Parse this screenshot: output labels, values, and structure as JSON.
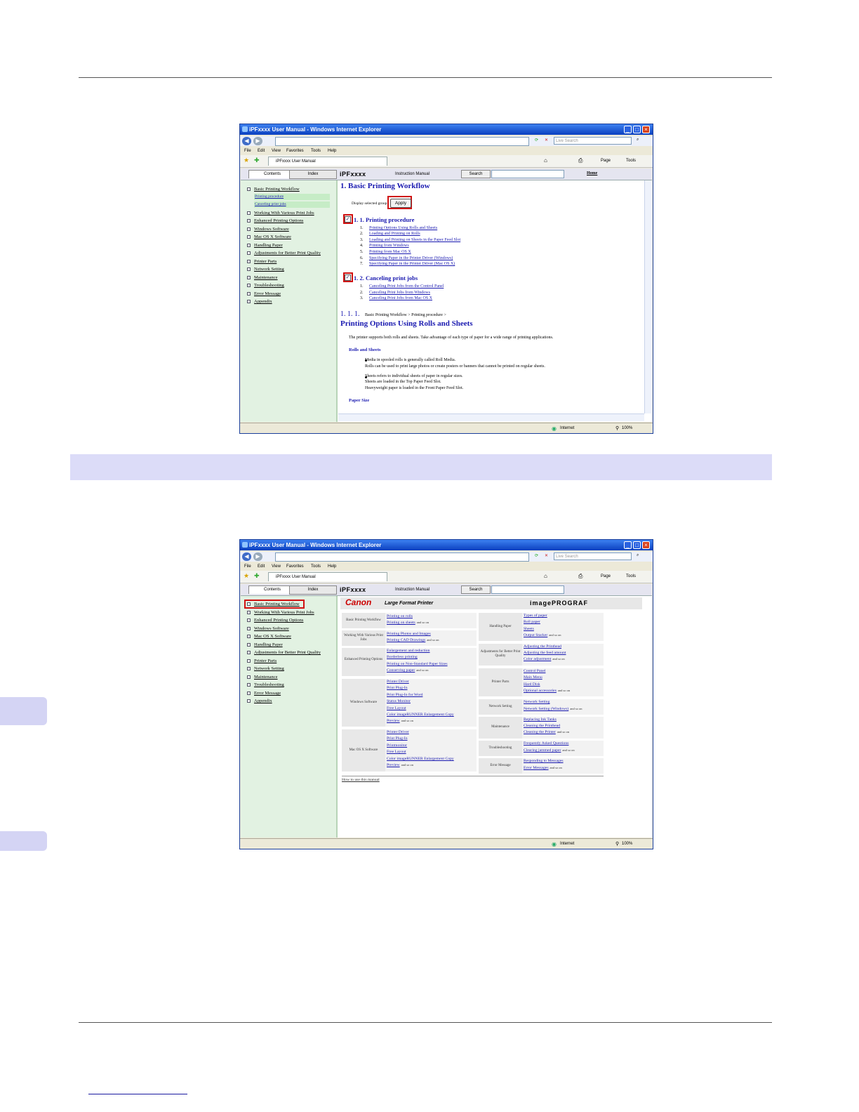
{
  "browser": {
    "title": "iPFxxxx User Manual - Windows Internet Explorer",
    "search_placeholder": "Live Search",
    "menus": [
      "File",
      "Edit",
      "View",
      "Favorites",
      "Tools",
      "Help"
    ],
    "tab_label": "iPFxxxx User Manual",
    "page_label": "Page",
    "tools_label": "Tools",
    "status_zone": "Internet",
    "zoom": "100%"
  },
  "help": {
    "tab_contents": "Contents",
    "tab_index": "Index",
    "brand": "iPFxxxx",
    "manual_label": "Instruction Manual",
    "search_button": "Search",
    "home_link": "Home",
    "sidebar": [
      "Basic Printing Workflow",
      "Working With Various Print Jobs",
      "Enhanced Printing Options",
      "Windows Software",
      "Mac OS X Software",
      "Handling Paper",
      "Adjustments for Better Print Quality",
      "Printer Parts",
      "Network Setting",
      "Maintenance",
      "Troubleshooting",
      "Error Message",
      "Appendix"
    ]
  },
  "screen1": {
    "sub_items": [
      "Printing procedure",
      "Canceling print jobs"
    ],
    "heading": "1. Basic Printing Workflow",
    "display_label": "Display selected group",
    "apply_button": "Apply",
    "group1": {
      "title": "1. 1. Printing procedure",
      "links": [
        "Printing Options Using Rolls and Sheets",
        "Loading and Printing on Rolls",
        "Loading and Printing on Sheets in the Paper Feed Slot",
        "Printing from Windows",
        "Printing from Mac OS X",
        "Specifying Paper in the Printer Driver (Windows)",
        "Specifying Paper in the Printer Driver (Mac OS X)"
      ]
    },
    "group2": {
      "title": "1. 2. Canceling print jobs",
      "links": [
        "Canceling Print Jobs from the Control Panel",
        "Canceling Print Jobs from Windows",
        "Canceling Print Jobs from Mac OS X"
      ]
    },
    "section_num": "1. 1. 1.",
    "breadcrumb": "Basic Printing Workflow > Printing procedure >",
    "section_title": "Printing Options Using Rolls and Sheets",
    "intro": "The printer supports both rolls and sheets. Take advantage of each type of paper for a wide range of printing applications.",
    "sub1": "Rolls and Sheets",
    "bullet1": [
      "Media in spooled rolls is generally called Roll Media.",
      "Rolls can be used to print large photos or create posters or banners that cannot be printed on regular sheets."
    ],
    "bullet2": [
      "Sheets refers to individual sheets of paper in regular sizes.",
      "Sheets are loaded in the Top Paper Feed Slot.",
      "Heavyweight paper is loaded in the Front Paper Feed Slot."
    ],
    "sub2": "Paper Size"
  },
  "screen2": {
    "canon": "Canon",
    "lfp": "Large Format Printer",
    "imageprograf": "imagePROGRAF",
    "suffix": "and so on",
    "left_groups": [
      {
        "label": "Basic Printing Workflow",
        "links": [
          "Printing on rolls",
          "Printing on sheets"
        ]
      },
      {
        "label": "Working With Various Print Jobs",
        "links": [
          "Printing Photos and Images",
          "Printing CAD Drawings"
        ]
      },
      {
        "label": "Enhanced Printing Options",
        "links": [
          "Enlargement and reduction",
          "Borderless printing",
          "Printing on Non-Standard Paper Sizes",
          "Conserving paper"
        ]
      },
      {
        "label": "Windows Software",
        "links": [
          "Printer Driver",
          "Print Plug-In",
          "Print Plug-In for Word",
          "Status Monitor",
          "Free Layout",
          "Color imageRUNNER Enlargement Copy",
          "Preview"
        ]
      },
      {
        "label": "Mac OS X Software",
        "links": [
          "Printer Driver",
          "Print Plug-In",
          "Printmonitor",
          "Free Layout",
          "Color imageRUNNER Enlargement Copy",
          "Preview"
        ]
      }
    ],
    "right_groups": [
      {
        "label": "Handling Paper",
        "links": [
          "Types of paper",
          "Roll paper",
          "Sheets",
          "Output Stacker"
        ]
      },
      {
        "label": "Adjustments for Better Print Quality",
        "links": [
          "Adjusting the Printhead",
          "Adjusting the feed amount",
          "Color adjustment"
        ]
      },
      {
        "label": "Printer Parts",
        "links": [
          "Control Panel",
          "Main Menu",
          "Hard Disk",
          "Optional accessories"
        ]
      },
      {
        "label": "Network Setting",
        "links": [
          "Network Setting",
          "Network Setting (Windows)"
        ]
      },
      {
        "label": "Maintenance",
        "links": [
          "Replacing Ink Tanks",
          "Cleaning the Printhead",
          "Cleaning the Printer"
        ]
      },
      {
        "label": "Troubleshooting",
        "links": [
          "Frequently Asked Questions",
          "Clearing jammed paper"
        ]
      },
      {
        "label": "Error Message",
        "links": [
          "Responding to Messages",
          "Error Messages"
        ]
      }
    ],
    "how_to": "How to use this manual"
  }
}
